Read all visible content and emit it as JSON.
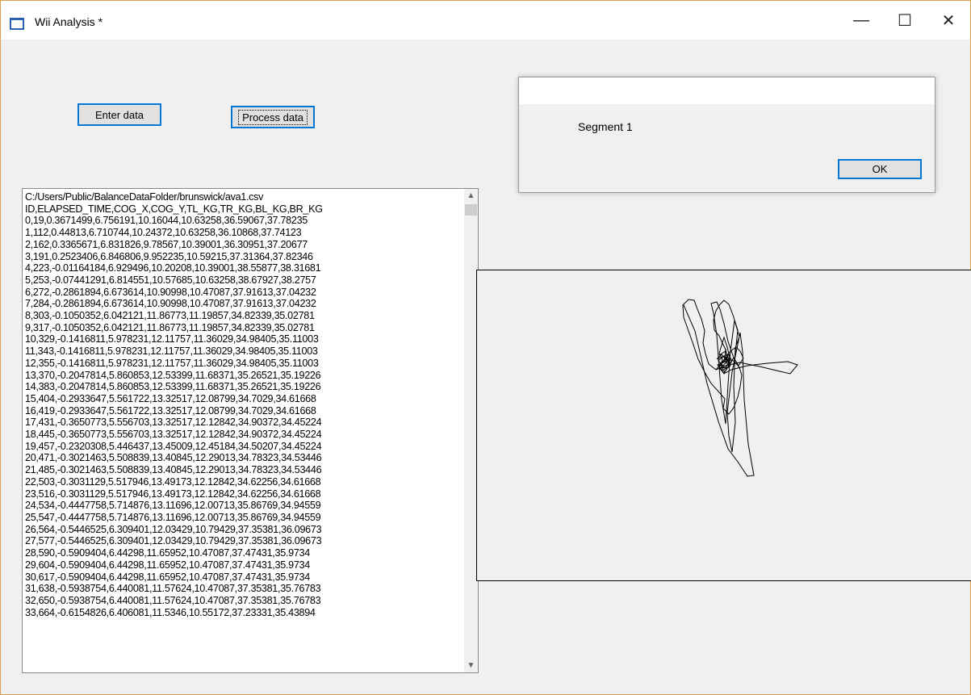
{
  "window": {
    "title": "Wii Analysis *",
    "minimize_glyph": "—",
    "maximize_glyph": "☐",
    "close_glyph": "✕"
  },
  "buttons": {
    "enter_data": "Enter data",
    "process_data": "Process data"
  },
  "listbox": {
    "lines": [
      "C:/Users/Public/BalanceDataFolder/brunswick/ava1.csv",
      "ID,ELAPSED_TIME,COG_X,COG_Y,TL_KG,TR_KG,BL_KG,BR_KG",
      "0,19,0.3671499,6.756191,10.16044,10.63258,36.59067,37.78235",
      "1,112,0.44813,6.710744,10.24372,10.63258,36.10868,37.74123",
      "2,162,0.3365671,6.831826,9.78567,10.39001,36.30951,37.20677",
      "3,191,0.2523406,6.846806,9.952235,10.59215,37.31364,37.82346",
      "4,223,-0.01164184,6.929496,10.20208,10.39001,38.55877,38.31681",
      "5,253,-0.07441291,6.814551,10.57685,10.63258,38.67927,38.2757",
      "6,272,-0.2861894,6.673614,10.90998,10.47087,37.91613,37.04232",
      "7,284,-0.2861894,6.673614,10.90998,10.47087,37.91613,37.04232",
      "8,303,-0.1050352,6.042121,11.86773,11.19857,34.82339,35.02781",
      "9,317,-0.1050352,6.042121,11.86773,11.19857,34.82339,35.02781",
      "10,329,-0.1416811,5.978231,12.11757,11.36029,34.98405,35.11003",
      "11,343,-0.1416811,5.978231,12.11757,11.36029,34.98405,35.11003",
      "12,355,-0.1416811,5.978231,12.11757,11.36029,34.98405,35.11003",
      "13,370,-0.2047814,5.860853,12.53399,11.68371,35.26521,35.19226",
      "14,383,-0.2047814,5.860853,12.53399,11.68371,35.26521,35.19226",
      "15,404,-0.2933647,5.561722,13.32517,12.08799,34.7029,34.61668",
      "16,419,-0.2933647,5.561722,13.32517,12.08799,34.7029,34.61668",
      "17,431,-0.3650773,5.556703,13.32517,12.12842,34.90372,34.45224",
      "18,445,-0.3650773,5.556703,13.32517,12.12842,34.90372,34.45224",
      "19,457,-0.2320308,5.446437,13.45009,12.45184,34.50207,34.45224",
      "20,471,-0.3021463,5.508839,13.40845,12.29013,34.78323,34.53446",
      "21,485,-0.3021463,5.508839,13.40845,12.29013,34.78323,34.53446",
      "22,503,-0.3031129,5.517946,13.49173,12.12842,34.62256,34.61668",
      "23,516,-0.3031129,5.517946,13.49173,12.12842,34.62256,34.61668",
      "24,534,-0.4447758,5.714876,13.11696,12.00713,35.86769,34.94559",
      "25,547,-0.4447758,5.714876,13.11696,12.00713,35.86769,34.94559",
      "26,564,-0.5446525,6.309401,12.03429,10.79429,37.35381,36.09673",
      "27,577,-0.5446525,6.309401,12.03429,10.79429,37.35381,36.09673",
      "28,590,-0.5909404,6.44298,11.65952,10.47087,37.47431,35.9734",
      "29,604,-0.5909404,6.44298,11.65952,10.47087,37.47431,35.9734",
      "30,617,-0.5909404,6.44298,11.65952,10.47087,37.47431,35.9734",
      "31,638,-0.5938754,6.440081,11.57624,10.47087,37.35381,35.76783",
      "32,650,-0.5938754,6.440081,11.57624,10.47087,37.35381,35.76783",
      "33,664,-0.6154826,6.406081,11.5346,10.55172,37.23331,35.43894"
    ],
    "scroll_up_glyph": "▲",
    "scroll_down_glyph": "▼"
  },
  "dialog": {
    "message": "Segment 1",
    "ok_label": "OK"
  },
  "trace": {
    "stroke": "#000000"
  }
}
